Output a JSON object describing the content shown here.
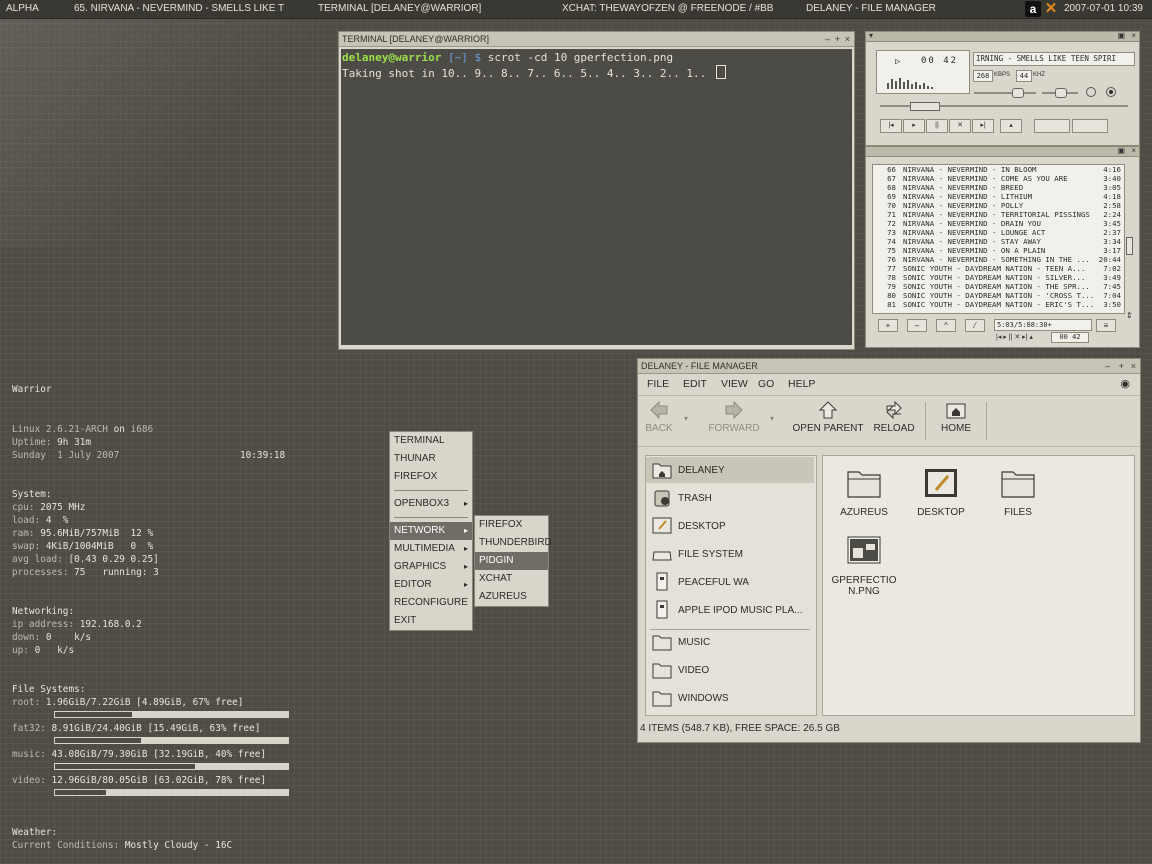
{
  "panel": {
    "workspace": "ALPHA",
    "tasks": [
      "65. NIRVANA - NEVERMIND - SMELLS LIKE T",
      "TERMINAL [DELANEY@WARRIOR]",
      "XCHAT: THEWAYOFZEN @ FREENODE / #BB",
      "DELANEY - FILE MANAGER"
    ],
    "clock": "2007-07-01 10:39",
    "tray_a": "a"
  },
  "terminal": {
    "title": "TERMINAL [DELANEY@WARRIOR]",
    "prompt_user": "delaney@warrior",
    "prompt_dir": "[~]",
    "prompt_sym": "$",
    "command": "scrot -cd 10 gperfection.png",
    "output": "Taking shot in 10.. 9.. 8.. 7.. 6.. 5.. 4.. 3.. 2.. 1.. "
  },
  "conky": {
    "host": "Warrior",
    "kernel_pre": "Linux 2.6.21-ARCH ",
    "kernel_on": "on",
    "kernel_arch": " i686",
    "uptime_label": "Uptime: ",
    "uptime": "9h 31m",
    "date": "Sunday  1 July 2007",
    "time": "10:39:18",
    "system_label": "System:",
    "cpu_label": "cpu: ",
    "cpu": "2075 MHz",
    "load_label": "load: ",
    "load": "4  %",
    "ram_label": "ram: ",
    "ram": "95.6MiB/757MiB  12 %",
    "swap_label": "swap: ",
    "swap": "4KiB/1004MiB   0  %",
    "avg_label": "avg load: ",
    "avg": "[0.43 0.29 0.25]",
    "proc_label": "processes: ",
    "proc": "75   running: 3",
    "net_label": "Networking:",
    "ip_label": "ip address: ",
    "ip": "192.168.0.2",
    "down_label": "down: ",
    "down": "0    k/s",
    "up_label": "up: ",
    "up": "0   k/s",
    "fs_label": "File Systems:",
    "fs": [
      {
        "label": "root: ",
        "value": "1.96GiB/7.22GiB [4.89GiB, 67% free]",
        "used": 0.33
      },
      {
        "label": "fat32: ",
        "value": "8.91GiB/24.40GiB [15.49GiB, 63% free]",
        "used": 0.37
      },
      {
        "label": "music: ",
        "value": "43.08GiB/79.30GiB [32.19GiB, 40% free]",
        "used": 0.6
      },
      {
        "label": "video: ",
        "value": "12.96GiB/80.05GiB [63.02GiB, 78% free]",
        "used": 0.22
      }
    ],
    "weather_label": "Weather:",
    "cond_label": "Current Conditions: ",
    "cond": "Mostly Cloudy - 16C"
  },
  "menu": {
    "items": [
      "TERMINAL",
      "THUNAR",
      "FIREFOX",
      "OPENBOX3",
      "NETWORK",
      "MULTIMEDIA",
      "GRAPHICS",
      "EDITOR",
      "RECONFIGURE",
      "EXIT"
    ],
    "sub": [
      "FIREFOX",
      "THUNDERBIRD",
      "PIDGIN",
      "XCHAT",
      "AZUREUS"
    ]
  },
  "fm": {
    "title": "DELANEY - FILE MANAGER",
    "menus": [
      "FILE",
      "EDIT",
      "VIEW",
      "GO",
      "HELP"
    ],
    "toolbar": {
      "back": "BACK",
      "forward": "FORWARD",
      "open_parent": "OPEN PARENT",
      "reload": "RELOAD",
      "home": "HOME"
    },
    "side": [
      "DELANEY",
      "TRASH",
      "DESKTOP",
      "FILE SYSTEM",
      "PEACEFUL WA",
      "APPLE IPOD MUSIC PLA...",
      "MUSIC",
      "VIDEO",
      "WINDOWS"
    ],
    "files": [
      "AZUREUS",
      "DESKTOP",
      "FILES",
      "GPERFECTIO",
      "N.PNG"
    ],
    "status": "4 ITEMS (548.7 KB), FREE SPACE: 26.5 GB"
  },
  "xmms": {
    "time": "00 42",
    "title": "IRNING - SMELLS LIKE TEEN SPIRI",
    "kbps": "268",
    "kbps_label": "KBPS",
    "khz": "44",
    "khz_label": "KHZ",
    "playlist": [
      {
        "n": "66",
        "t": "NIRVANA - NEVERMIND - IN BLOOM",
        "d": "4:16"
      },
      {
        "n": "67",
        "t": "NIRVANA - NEVERMIND - COME AS YOU ARE",
        "d": "3:40"
      },
      {
        "n": "68",
        "t": "NIRVANA - NEVERMIND - BREED",
        "d": "3:05"
      },
      {
        "n": "69",
        "t": "NIRVANA - NEVERMIND - LITHIUM",
        "d": "4:18"
      },
      {
        "n": "70",
        "t": "NIRVANA - NEVERMIND - POLLY",
        "d": "2:58"
      },
      {
        "n": "71",
        "t": "NIRVANA - NEVERMIND - TERRITORIAL PISSINGS",
        "d": "2:24"
      },
      {
        "n": "72",
        "t": "NIRVANA - NEVERMIND - DRAIN YOU",
        "d": "3:45"
      },
      {
        "n": "73",
        "t": "NIRVANA - NEVERMIND - LOUNGE ACT",
        "d": "2:37"
      },
      {
        "n": "74",
        "t": "NIRVANA - NEVERMIND - STAY AWAY",
        "d": "3:34"
      },
      {
        "n": "75",
        "t": "NIRVANA - NEVERMIND - ON A PLAIN",
        "d": "3:17"
      },
      {
        "n": "76",
        "t": "NIRVANA - NEVERMIND - SOMETHING IN THE ...",
        "d": "20:44"
      },
      {
        "n": "77",
        "t": "SONIC YOUTH - DAYDREAM NATION - TEEN A...",
        "d": "7:02"
      },
      {
        "n": "78",
        "t": "SONIC YOUTH - DAYDREAM NATION - SILVER...",
        "d": "3:49"
      },
      {
        "n": "79",
        "t": "SONIC YOUTH - DAYDREAM NATION - THE SPR...",
        "d": "7:45"
      },
      {
        "n": "80",
        "t": "SONIC YOUTH - DAYDREAM NATION - 'CROSS T...",
        "d": "7:04"
      },
      {
        "n": "81",
        "t": "SONIC YOUTH - DAYDREAM NATION - ERIC'S T...",
        "d": "3:50"
      }
    ],
    "total": "5:03/5:08:30+",
    "mini_time": "00 42"
  }
}
